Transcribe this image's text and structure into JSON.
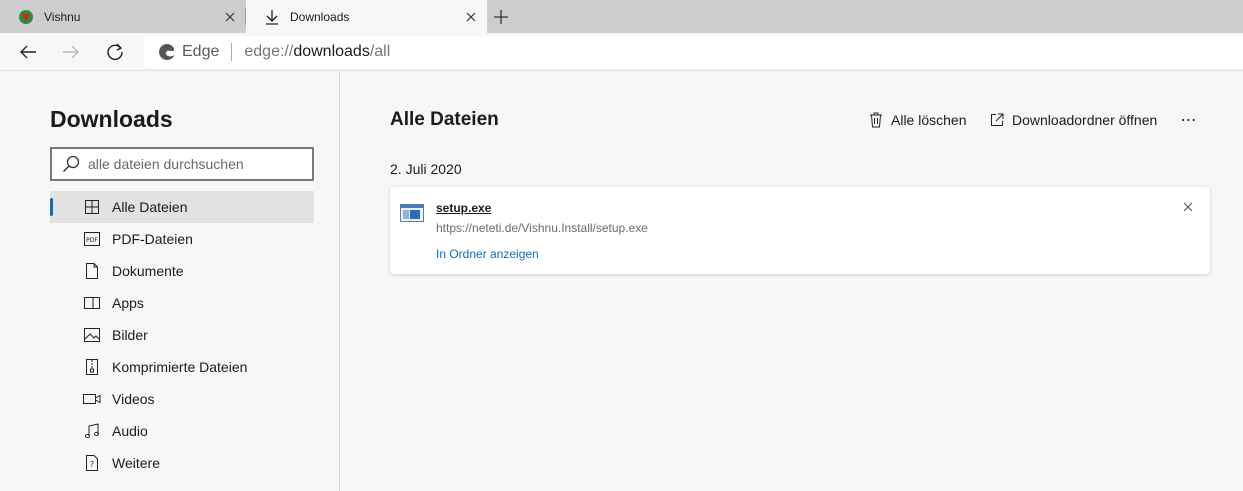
{
  "tabs": [
    {
      "label": "Vishnu",
      "icon": "vishnu-favicon"
    },
    {
      "label": "Downloads",
      "icon": "download-icon"
    }
  ],
  "address": {
    "brand": "Edge",
    "url_prefix": "edge://",
    "url_host": "downloads",
    "url_path": "/all"
  },
  "sidebar": {
    "title": "Downloads",
    "search_placeholder": "alle dateien durchsuchen",
    "items": [
      {
        "label": "Alle Dateien",
        "icon": "grid-icon"
      },
      {
        "label": "PDF-Dateien",
        "icon": "pdf-icon"
      },
      {
        "label": "Dokumente",
        "icon": "document-icon"
      },
      {
        "label": "Apps",
        "icon": "app-icon"
      },
      {
        "label": "Bilder",
        "icon": "image-icon"
      },
      {
        "label": "Komprimierte Dateien",
        "icon": "zip-icon"
      },
      {
        "label": "Videos",
        "icon": "video-icon"
      },
      {
        "label": "Audio",
        "icon": "music-icon"
      },
      {
        "label": "Weitere",
        "icon": "unknown-file-icon"
      }
    ]
  },
  "main": {
    "title": "Alle Dateien",
    "clear_all": "Alle löschen",
    "open_folder": "Downloadordner öffnen",
    "more": "⋯",
    "date": "2. Juli 2020",
    "download": {
      "filename": "setup.exe",
      "url": "https://neteti.de/Vishnu.Install/setup.exe",
      "action": "In Ordner anzeigen"
    }
  },
  "colors": {
    "accent": "#0f6cbd",
    "favicon_red": "#c42b1c",
    "favicon_green": "#2e8b3a"
  }
}
